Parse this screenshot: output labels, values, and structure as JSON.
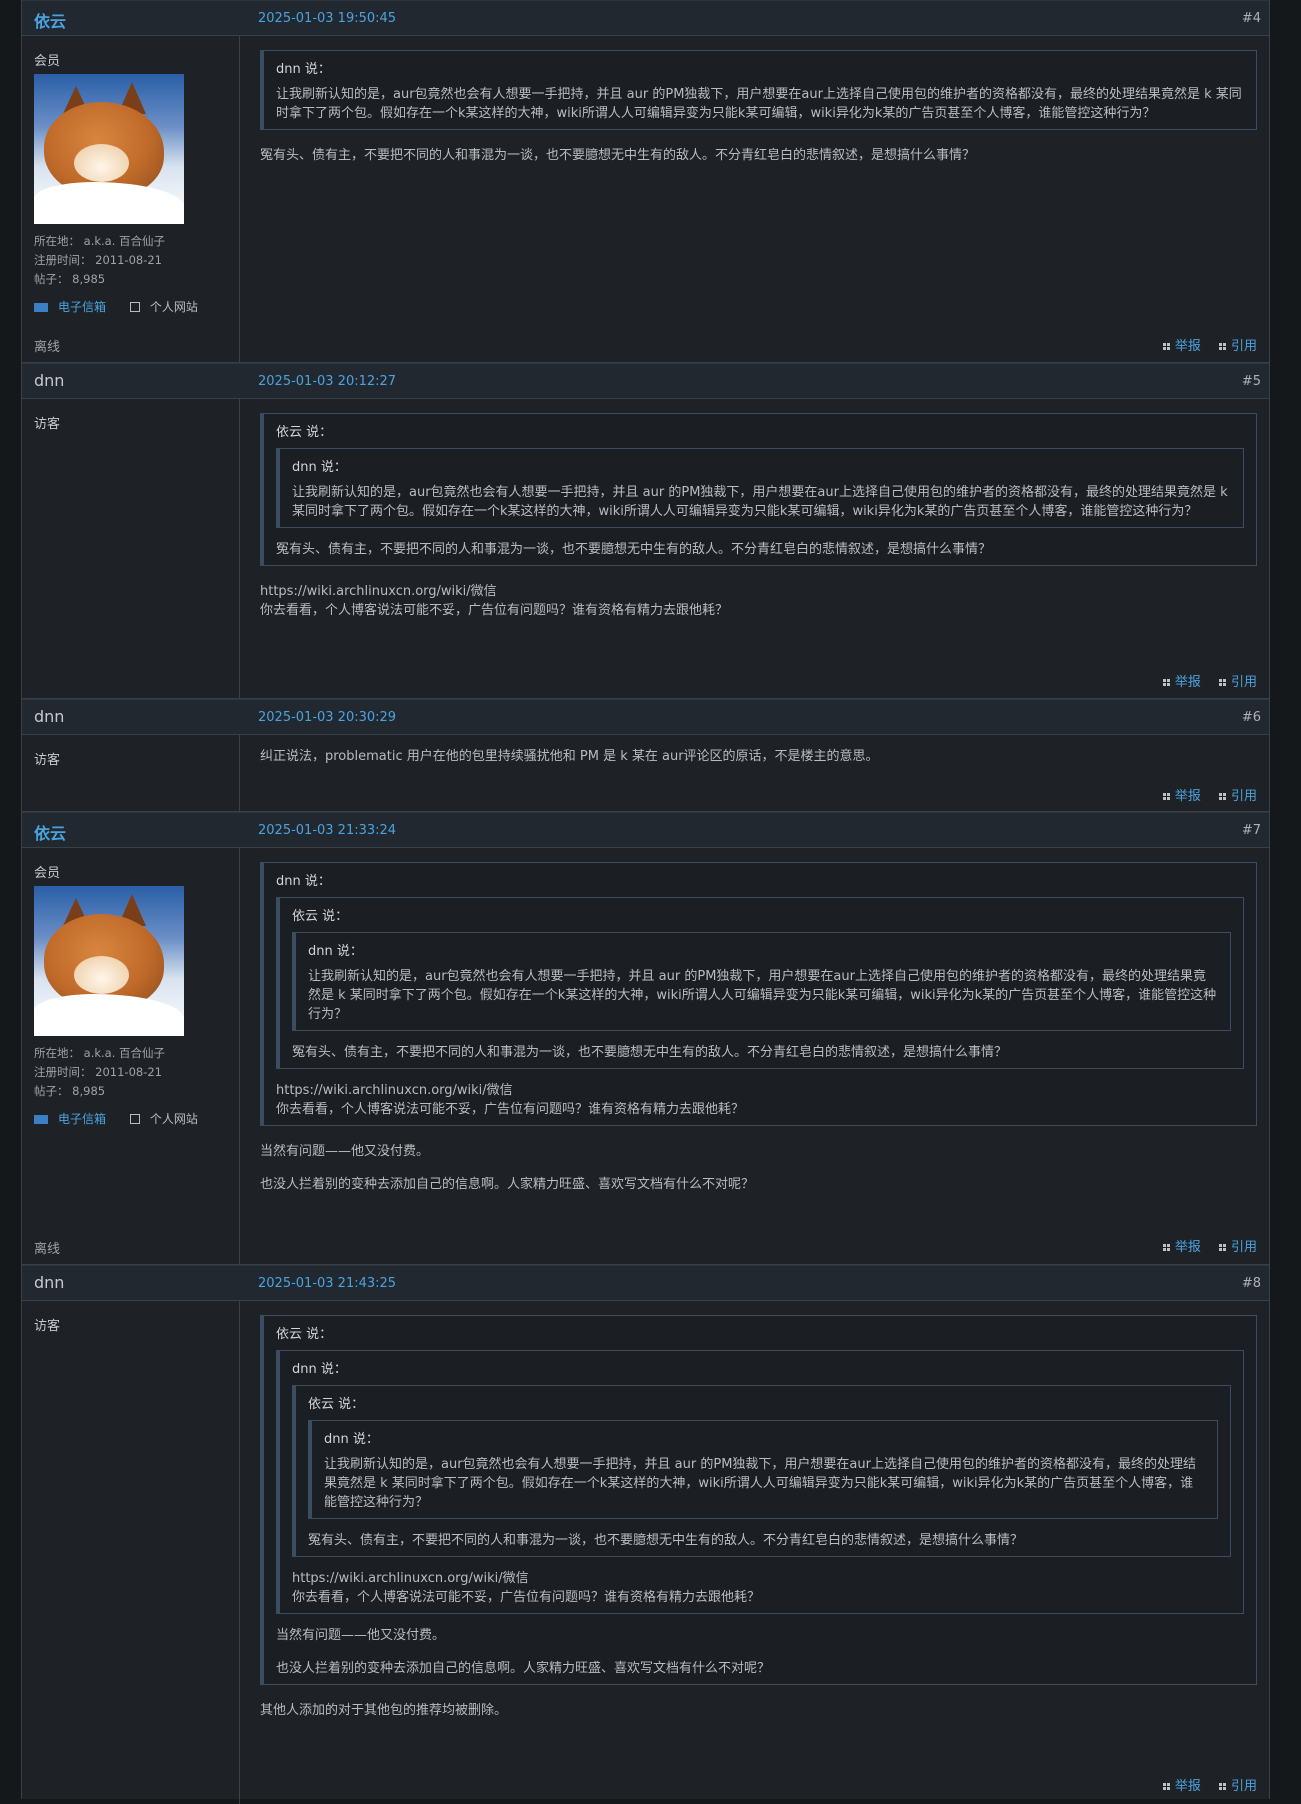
{
  "posts": [
    {
      "author": "依云",
      "time": "2025-01-03 19:50:45",
      "num": "#4",
      "user_title": "会员",
      "location": "所在地： a.k.a. 百合仙子",
      "registered": "注册时间： 2011-08-21",
      "posts_count": "帖子： 8,985",
      "email_label": "电子信箱",
      "site_label": "个人网站",
      "status": "离线",
      "quote": {
        "author": "dnn 说：",
        "text": "让我刷新认知的是，aur包竟然也会有人想要一手把持，并且 aur 的PM独裁下，用户想要在aur上选择自己使用包的维护者的资格都没有，最终的处理结果竟然是 k 某同时拿下了两个包。假如存在一个k某这样的大神，wiki所谓人人可编辑异变为只能k某可编辑，wiki异化为k某的广告页甚至个人博客，谁能管控这种行为？"
      },
      "text": "冤有头、债有主，不要把不同的人和事混为一谈，也不要臆想无中生有的敌人。不分青红皂白的悲情叙述，是想搞什么事情？",
      "report": "举报",
      "quote_btn": "引用"
    },
    {
      "author": "dnn",
      "time": "2025-01-03 20:12:27",
      "num": "#5",
      "user_title": "访客",
      "quote": {
        "author": "依云 说：",
        "inner": {
          "author": "dnn 说：",
          "text": "让我刷新认知的是，aur包竟然也会有人想要一手把持，并且 aur 的PM独裁下，用户想要在aur上选择自己使用包的维护者的资格都没有，最终的处理结果竟然是 k 某同时拿下了两个包。假如存在一个k某这样的大神，wiki所谓人人可编辑异变为只能k某可编辑，wiki异化为k某的广告页甚至个人博客，谁能管控这种行为？"
        },
        "text": "冤有头、债有主，不要把不同的人和事混为一谈，也不要臆想无中生有的敌人。不分青红皂白的悲情叙述，是想搞什么事情？"
      },
      "text1": "https://wiki.archlinuxcn.org/wiki/微信",
      "text2": "你去看看，个人博客说法可能不妥，广告位有问题吗？谁有资格有精力去跟他耗？",
      "report": "举报",
      "quote_btn": "引用"
    },
    {
      "author": "dnn",
      "time": "2025-01-03 20:30:29",
      "num": "#6",
      "user_title": "访客",
      "text": "纠正说法，problematic 用户在他的包里持续骚扰他和 PM 是 k 某在 aur评论区的原话，不是楼主的意思。",
      "report": "举报",
      "quote_btn": "引用"
    },
    {
      "author": "依云",
      "time": "2025-01-03 21:33:24",
      "num": "#7",
      "user_title": "会员",
      "location": "所在地： a.k.a. 百合仙子",
      "registered": "注册时间： 2011-08-21",
      "posts_count": "帖子： 8,985",
      "email_label": "电子信箱",
      "site_label": "个人网站",
      "status": "离线",
      "quote": {
        "author": "dnn 说：",
        "inner_author": "依云 说：",
        "inner_inner_author": "dnn 说：",
        "inner_inner_text": "让我刷新认知的是，aur包竟然也会有人想要一手把持，并且 aur 的PM独裁下，用户想要在aur上选择自己使用包的维护者的资格都没有，最终的处理结果竟然是 k 某同时拿下了两个包。假如存在一个k某这样的大神，wiki所谓人人可编辑异变为只能k某可编辑，wiki异化为k某的广告页甚至个人博客，谁能管控这种行为？",
        "inner_text": "冤有头、债有主，不要把不同的人和事混为一谈，也不要臆想无中生有的敌人。不分青红皂白的悲情叙述，是想搞什么事情？",
        "text1": "https://wiki.archlinuxcn.org/wiki/微信",
        "text2": "你去看看，个人博客说法可能不妥，广告位有问题吗？谁有资格有精力去跟他耗？"
      },
      "text1": "当然有问题——他又没付费。",
      "text2": "也没人拦着别的变种去添加自己的信息啊。人家精力旺盛、喜欢写文档有什么不对呢？",
      "report": "举报",
      "quote_btn": "引用"
    },
    {
      "author": "dnn",
      "time": "2025-01-03 21:43:25",
      "num": "#8",
      "user_title": "访客",
      "quote": {
        "a1": "依云 说：",
        "a2": "dnn 说：",
        "a3": "依云 说：",
        "a4": "dnn 说：",
        "t4": "让我刷新认知的是，aur包竟然也会有人想要一手把持，并且 aur 的PM独裁下，用户想要在aur上选择自己使用包的维护者的资格都没有，最终的处理结果竟然是 k 某同时拿下了两个包。假如存在一个k某这样的大神，wiki所谓人人可编辑异变为只能k某可编辑，wiki异化为k某的广告页甚至个人博客，谁能管控这种行为？",
        "t3": "冤有头、债有主，不要把不同的人和事混为一谈，也不要臆想无中生有的敌人。不分青红皂白的悲情叙述，是想搞什么事情？",
        "t2a": "https://wiki.archlinuxcn.org/wiki/微信",
        "t2b": "你去看看，个人博客说法可能不妥，广告位有问题吗？谁有资格有精力去跟他耗？",
        "t1a": "当然有问题——他又没付费。",
        "t1b": "也没人拦着别的变种去添加自己的信息啊。人家精力旺盛、喜欢写文档有什么不对呢？"
      },
      "text": "其他人添加的对于其他包的推荐均被删除。",
      "report": "举报",
      "quote_btn": "引用"
    }
  ]
}
